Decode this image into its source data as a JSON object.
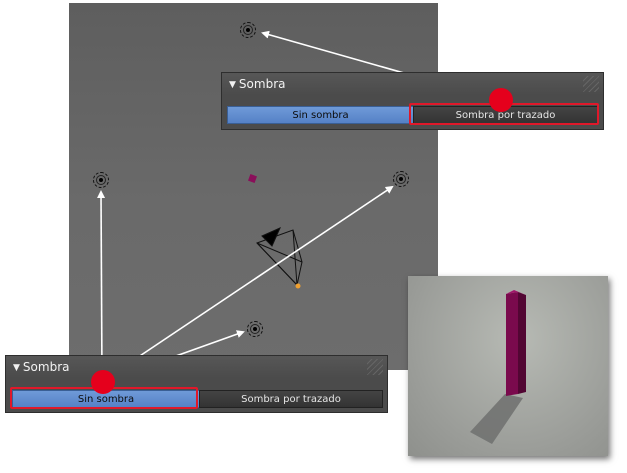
{
  "top_panel": {
    "title": "Sombra",
    "option_none": "Sin sombra",
    "option_ray": "Sombra por trazado",
    "selected": "option_ray"
  },
  "bottom_panel": {
    "title": "Sombra",
    "option_none": "Sin sombra",
    "option_ray": "Sombra por trazado",
    "selected": "option_none"
  },
  "colors": {
    "highlight": "#e0182a",
    "active_button": "#5b87cc",
    "object": "#8a0f5a"
  },
  "icons": [
    "lamp-icon",
    "camera-icon",
    "collapse-triangle-icon",
    "panel-grip-icon"
  ]
}
